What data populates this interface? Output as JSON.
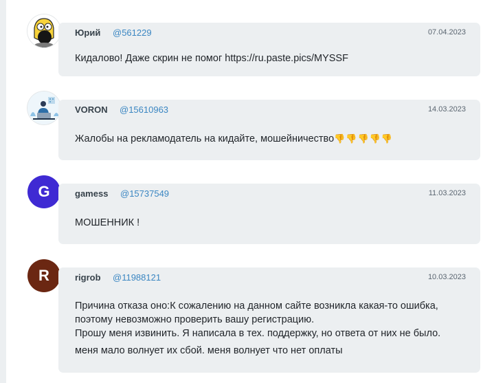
{
  "comments": [
    {
      "author": "Юрий",
      "handle": "@561229",
      "date": "07.04.2023",
      "avatar_icon": "cartoon-character-icon",
      "lines": [
        "Кидалово! Даже скрин не помог https://ru.paste.pics/MYSSF"
      ]
    },
    {
      "author": "VORON",
      "handle": "@15610963",
      "date": "14.03.2023",
      "avatar_icon": "person-at-laptop-icon",
      "text": "Жалобы на рекламодатель на кидайте, мошейничество",
      "emoji": "👎👎👎👎👎"
    },
    {
      "author": "gamess",
      "handle": "@15737549",
      "date": "11.03.2023",
      "avatar_letter": "G",
      "avatar_color": "#3f2ad3",
      "lines": [
        "МОШЕННИК !"
      ]
    },
    {
      "author": "rigrob",
      "handle": "@11988121",
      "date": "10.03.2023",
      "avatar_letter": "R",
      "avatar_color": "#6b2712",
      "lines": [
        "Причина отказа оно:К сожалению на данном сайте возникла какая-то ошибка,",
        "поэтому невозможно проверить вашу регистрацию.",
        "Прошу меня извинить. Я написала в тех. поддержку, но ответа от них не было.",
        "меня мало волнует  их сбой. меня волнует что нет оплаты"
      ]
    }
  ]
}
